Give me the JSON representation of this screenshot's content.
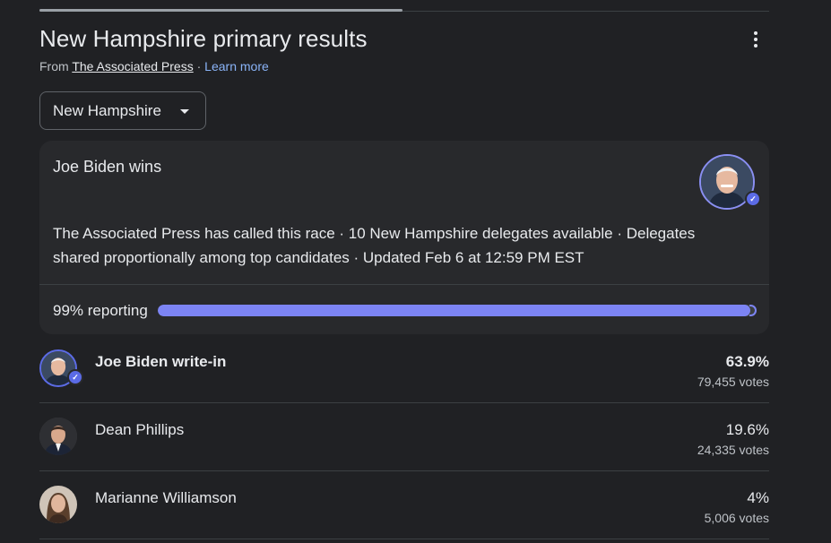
{
  "header": {
    "title": "New Hampshire primary results",
    "source_prefix": "From ",
    "source_name": "The Associated Press",
    "separator": " · ",
    "learn_more": "Learn more"
  },
  "state_select": {
    "selected": "New Hampshire"
  },
  "summary": {
    "winner_text": "Joe Biden wins",
    "description": "The Associated Press has called this race · 10 New Hampshire delegates available · Delegates shared proportionally among top candidates · Updated Feb 6 at 12:59 PM EST",
    "reporting_label": "99% reporting",
    "reporting_fraction": 0.99
  },
  "candidates": [
    {
      "name": "Joe Biden write-in",
      "percent": "63.9%",
      "votes": "79,455 votes",
      "winner": true
    },
    {
      "name": "Dean Phillips",
      "percent": "19.6%",
      "votes": "24,335 votes",
      "winner": false
    },
    {
      "name": "Marianne Williamson",
      "percent": "4%",
      "votes": "5,006 votes",
      "winner": false
    }
  ],
  "colors": {
    "background": "#202124",
    "card": "#28292c",
    "accent": "#7c84f4",
    "link": "#8ab4f8"
  },
  "icons": [
    "more-vert-icon",
    "dropdown-caret-icon",
    "verified-check-icon"
  ]
}
